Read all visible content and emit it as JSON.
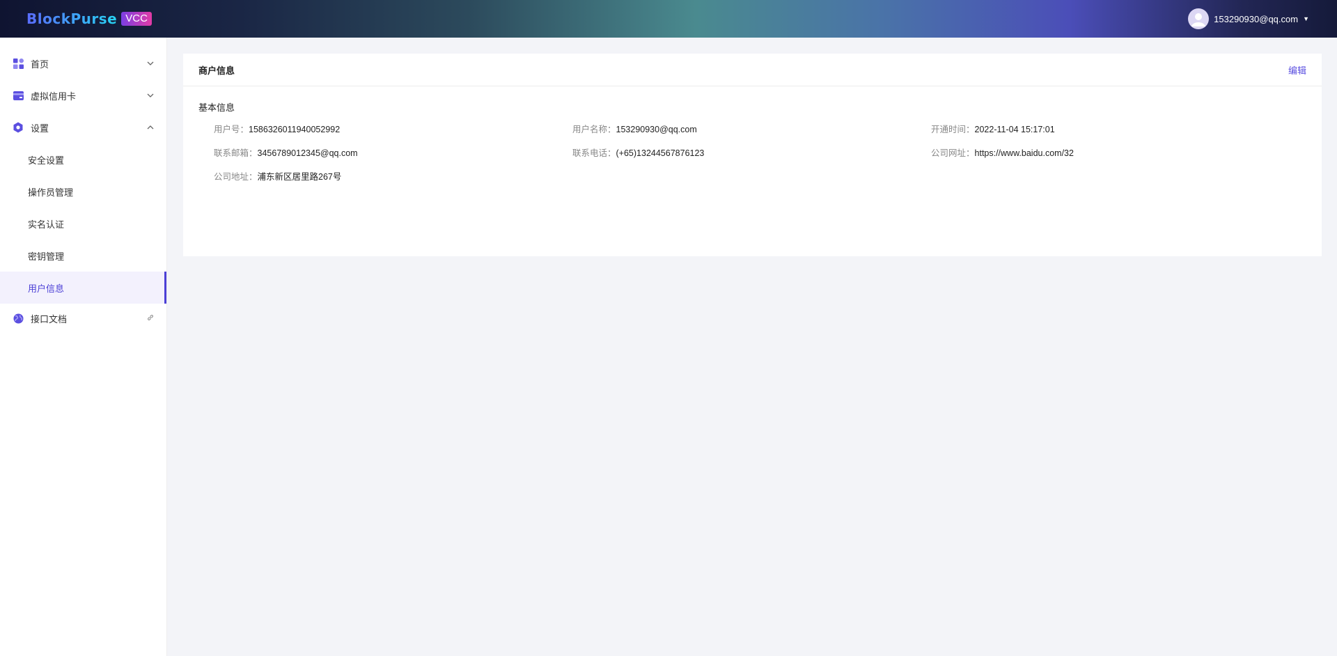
{
  "header": {
    "logo_text": "BlockPurse",
    "logo_badge": "VCC",
    "user_email": "153290930@qq.com"
  },
  "sidebar": {
    "items": [
      {
        "label": "首页",
        "icon": "dashboard-icon",
        "arrow": "down"
      },
      {
        "label": "虚拟信用卡",
        "icon": "card-icon",
        "arrow": "down"
      },
      {
        "label": "设置",
        "icon": "settings-icon",
        "arrow": "up"
      }
    ],
    "sub_items": [
      {
        "label": "安全设置"
      },
      {
        "label": "操作员管理"
      },
      {
        "label": "实名认证"
      },
      {
        "label": "密钥管理"
      },
      {
        "label": "用户信息",
        "active": true
      }
    ],
    "docs": {
      "label": "接口文档",
      "icon": "globe-icon"
    }
  },
  "card": {
    "title": "商户信息",
    "edit_label": "编辑",
    "section_title": "基本信息",
    "fields": [
      {
        "key": "用户号：",
        "value": "1586326011940052992"
      },
      {
        "key": "用户名称：",
        "value": "153290930@qq.com"
      },
      {
        "key": "开通时间：",
        "value": "2022-11-04 15:17:01"
      },
      {
        "key": "联系邮箱：",
        "value": "3456789012345@qq.com"
      },
      {
        "key": "联系电话：",
        "value": "(+65)13244567876123"
      },
      {
        "key": "公司网址：",
        "value": "https://www.baidu.com/32"
      },
      {
        "key": "公司地址：",
        "value": "浦东新区居里路267号"
      }
    ]
  },
  "colors": {
    "accent": "#4b3fd6",
    "link": "#5b4fe0"
  }
}
